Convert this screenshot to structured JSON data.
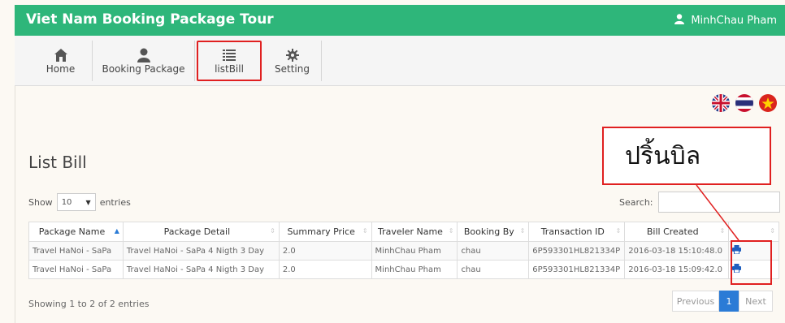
{
  "header": {
    "title": "Viet Nam Booking Package Tour",
    "user_name": "MinhChau  Pham"
  },
  "nav": {
    "items": [
      {
        "label": "Home",
        "icon": "home-icon"
      },
      {
        "label": "Booking Package",
        "icon": "user-icon"
      },
      {
        "label": "listBill",
        "icon": "list-icon",
        "active": true
      },
      {
        "label": "Setting",
        "icon": "gear-icon"
      }
    ]
  },
  "languages": [
    "en-flag-icon",
    "th-flag-icon",
    "vn-flag-icon"
  ],
  "page": {
    "title": "List Bill"
  },
  "callout": {
    "text": "ปริ้นบิล"
  },
  "table_controls": {
    "show_label": "Show",
    "length_value": "10",
    "entries_label": "entries",
    "search_label": "Search:"
  },
  "table": {
    "columns": [
      "Package Name",
      "Package Detail",
      "Summary Price",
      "Traveler Name",
      "Booking By",
      "Transaction ID",
      "Bill Created",
      ""
    ],
    "rows": [
      [
        "Travel HaNoi - SaPa",
        "Travel HaNoi - SaPa 4 Nigth 3 Day",
        "2.0",
        "MinhChau  Pham",
        "chau",
        "6P593301HL821334P",
        "2016-03-18 15:10:48.0"
      ],
      [
        "Travel HaNoi - SaPa",
        "Travel HaNoi - SaPa 4 Nigth 3 Day",
        "2.0",
        "MinhChau  Pham",
        "chau",
        "6P593301HL821334P",
        "2016-03-18 15:09:42.0"
      ]
    ]
  },
  "footer": {
    "info": "Showing 1 to 2 of 2 entries",
    "previous": "Previous",
    "current_page": "1",
    "next": "Next"
  },
  "colors": {
    "header": "#2eb67a",
    "accent": "#2b7bd6",
    "highlight": "#e02020"
  }
}
